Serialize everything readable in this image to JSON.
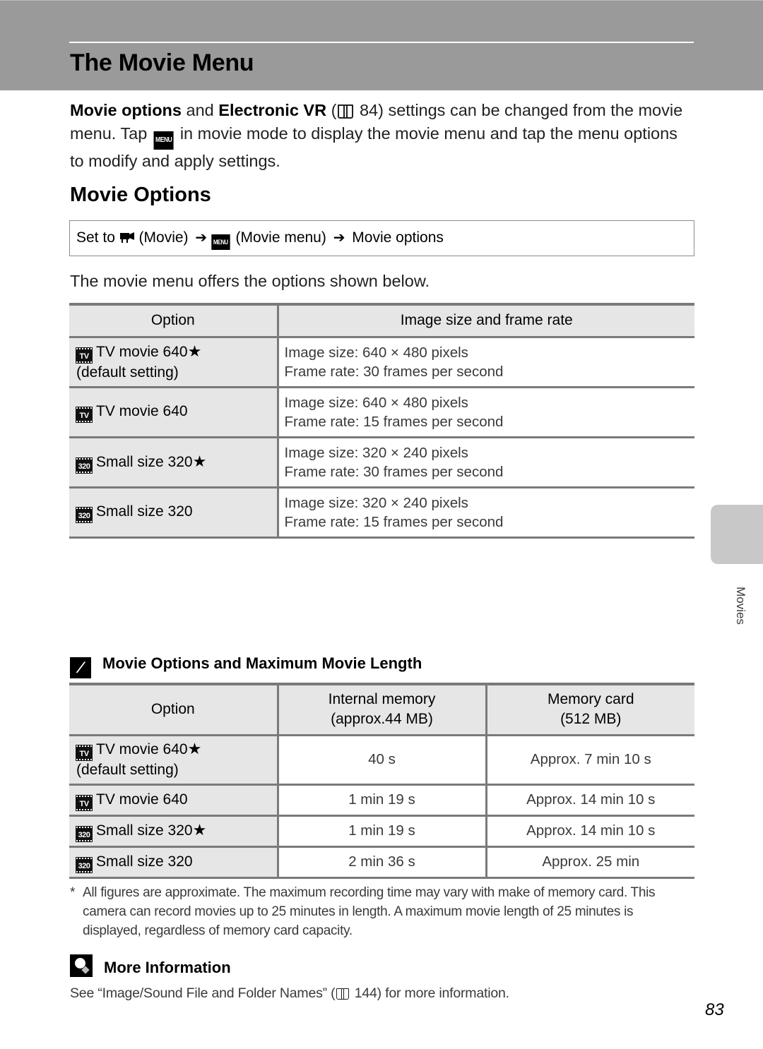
{
  "header": {
    "title": "The Movie Menu"
  },
  "intro": {
    "bold1": "Movie options",
    "and": " and ",
    "bold2": "Electronic VR",
    "ref_open": " (",
    "ref_page": " 84) settings can be changed from the movie menu. Tap ",
    "menu_glyph": "MENU",
    "rest": " in movie mode to display the movie menu and tap the menu options to modify and apply settings."
  },
  "section": {
    "title": "Movie Options"
  },
  "set_to": {
    "prefix": "Set to ",
    "movie_label": " (Movie) ",
    "arrow": "➔",
    "menu_glyph": "MENU",
    "menu_label": " (Movie menu) ",
    "target": " Movie options"
  },
  "offers_text": "The movie menu offers the options shown below.",
  "options_table": {
    "headers": [
      "Option",
      "Image size and frame rate"
    ],
    "rows": [
      {
        "icon": "TV",
        "label": "TV movie 640",
        "star": "★",
        "sub": "(default setting)",
        "line1": "Image size: 640 × 480 pixels",
        "line2": "Frame rate: 30 frames per second"
      },
      {
        "icon": "TV",
        "label": "TV movie 640",
        "star": "",
        "sub": "",
        "line1": "Image size: 640 × 480 pixels",
        "line2": "Frame rate: 15 frames per second"
      },
      {
        "icon": "320",
        "label": "Small size 320",
        "star": "★",
        "sub": "",
        "line1": "Image size: 320 × 240 pixels",
        "line2": "Frame rate: 30 frames per second"
      },
      {
        "icon": "320",
        "label": "Small size 320",
        "star": "",
        "sub": "",
        "line1": "Image size: 320 × 240 pixels",
        "line2": "Frame rate: 15 frames per second"
      }
    ]
  },
  "note": {
    "icon": "paperclip-note",
    "title": "Movie Options and Maximum Movie Length"
  },
  "length_table": {
    "headers": [
      {
        "line1": "Option",
        "line2": ""
      },
      {
        "line1": "Internal memory",
        "line2": "(approx.44 MB)"
      },
      {
        "line1": "Memory card",
        "line2": "(512 MB)"
      }
    ],
    "rows": [
      {
        "icon": "TV",
        "label": "TV movie 640",
        "star": "★",
        "sub": "(default setting)",
        "internal": "40 s",
        "card": "Approx. 7 min 10 s"
      },
      {
        "icon": "TV",
        "label": "TV movie 640",
        "star": "",
        "sub": "",
        "internal": "1 min 19 s",
        "card": "Approx. 14 min 10 s"
      },
      {
        "icon": "320",
        "label": "Small size 320",
        "star": "★",
        "sub": "",
        "internal": "1 min 19 s",
        "card": "Approx. 14 min 10 s"
      },
      {
        "icon": "320",
        "label": "Small size 320",
        "star": "",
        "sub": "",
        "internal": "2 min 36 s",
        "card": "Approx. 25 min"
      }
    ]
  },
  "footnote": {
    "marker": "*",
    "text": "All figures are approximate. The maximum recording time may vary with make of memory card. This camera can record movies up to 25 minutes in length. A maximum movie length of 25 minutes is displayed, regardless of memory card capacity."
  },
  "more_info": {
    "title": "More Information",
    "text_before": "See “Image/Sound File and Folder Names” (",
    "text_after": " 144) for more information."
  },
  "side_tab": {
    "label": "Movies"
  },
  "page_number": "83"
}
